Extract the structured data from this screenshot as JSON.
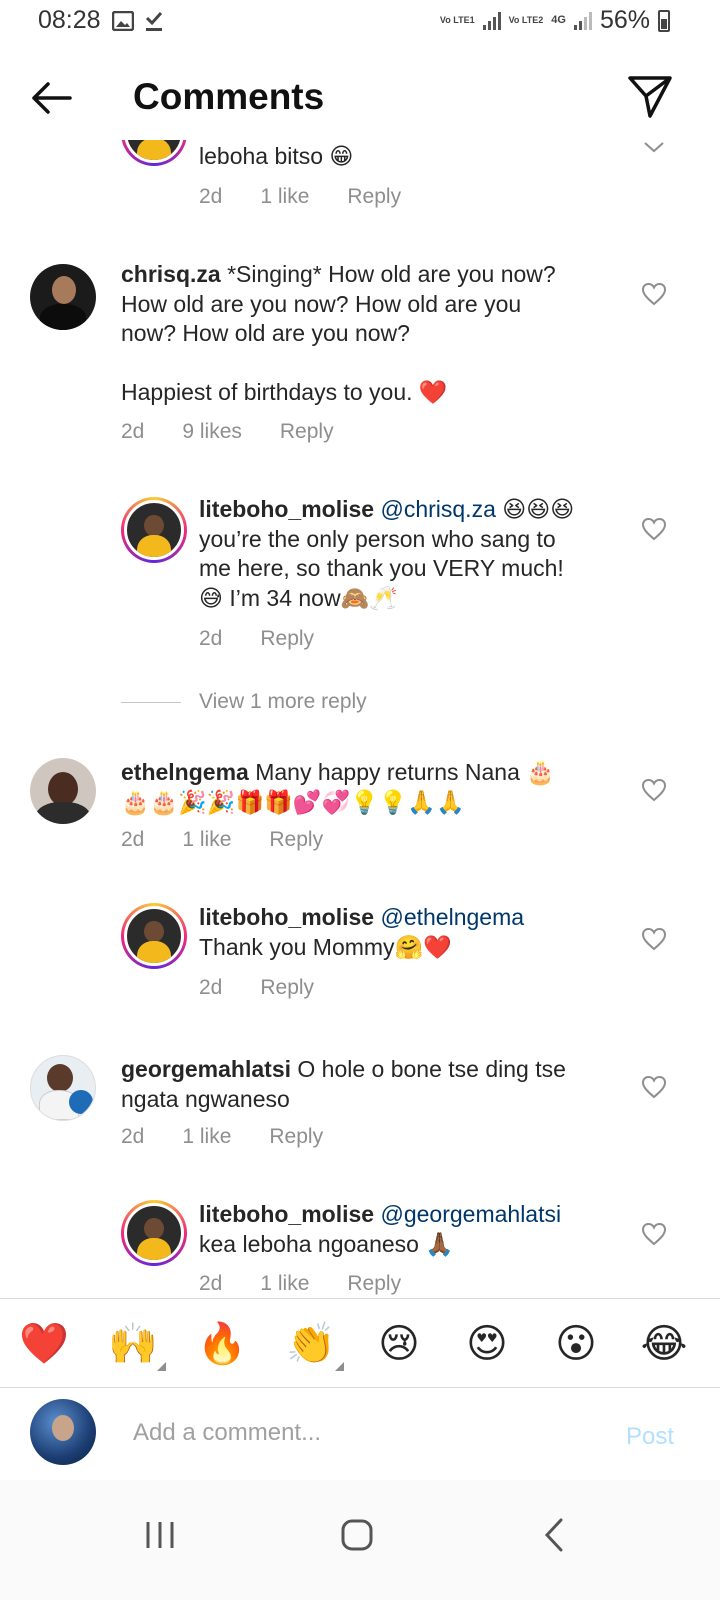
{
  "status_bar": {
    "time": "08:28",
    "sim1": "Vo LTE1",
    "sim2": "Vo LTE2",
    "network": "4G",
    "battery": "56%"
  },
  "header": {
    "title": "Comments",
    "back_icon": "arrow-left-icon",
    "share_icon": "paper-plane-icon"
  },
  "comments": [
    {
      "id": "c0",
      "partial": true,
      "text": "leboha bitso 😁",
      "time": "2d",
      "likes": "1 like",
      "reply": "Reply"
    },
    {
      "id": "c1",
      "username": "chrisq.za",
      "text_line1": "*Singing* How old are you now?",
      "text_line2": "How old are you now? How old are you",
      "text_line3": "now? How old are you now?",
      "text_line4": "Happiest of birthdays to you. ❤️",
      "time": "2d",
      "likes": "9 likes",
      "reply": "Reply"
    },
    {
      "id": "r1",
      "username": "liteboho_molise",
      "mention": "@chrisq.za",
      "text_emoji": "😆😆😆",
      "text_line2": "you’re the only person who sang to",
      "text_line3": "me here, so thank you VERY much!",
      "text_line4": "😅 I’m 34 now🙈🥂",
      "time": "2d",
      "reply": "Reply"
    },
    {
      "id": "vm1",
      "view_more": "View 1 more reply"
    },
    {
      "id": "c2",
      "username": "ethelngema",
      "text_line1": "Many happy returns Nana 🎂",
      "text_line2": "🎂🎂🎉🎉🎁🎁💕💞💡💡🙏🙏",
      "time": "2d",
      "likes": "1 like",
      "reply": "Reply"
    },
    {
      "id": "r2",
      "username": "liteboho_molise",
      "mention": "@ethelngema",
      "text_line2": "Thank you Mommy🤗❤️",
      "time": "2d",
      "reply": "Reply"
    },
    {
      "id": "c3",
      "username": "georgemahlatsi",
      "text_line1": "O hole o bone tse ding tse",
      "text_line2": "ngata ngwaneso",
      "time": "2d",
      "likes": "1 like",
      "reply": "Reply"
    },
    {
      "id": "r3",
      "username": "liteboho_molise",
      "mention": "@georgemahlatsi",
      "text_line2": "kea leboha ngoaneso 🙏🏾",
      "time": "2d",
      "likes": "1 like",
      "reply": "Reply"
    }
  ],
  "emoji_bar": [
    "❤️",
    "🙌",
    "🔥",
    "👏",
    "😢",
    "😍",
    "😮",
    "😂"
  ],
  "compose": {
    "placeholder": "Add a comment...",
    "post_label": "Post"
  },
  "colors": {
    "mention": "#00376b",
    "muted": "#8e8e8e",
    "post_disabled": "#b2dffc",
    "heart_like": "#ed4956"
  }
}
